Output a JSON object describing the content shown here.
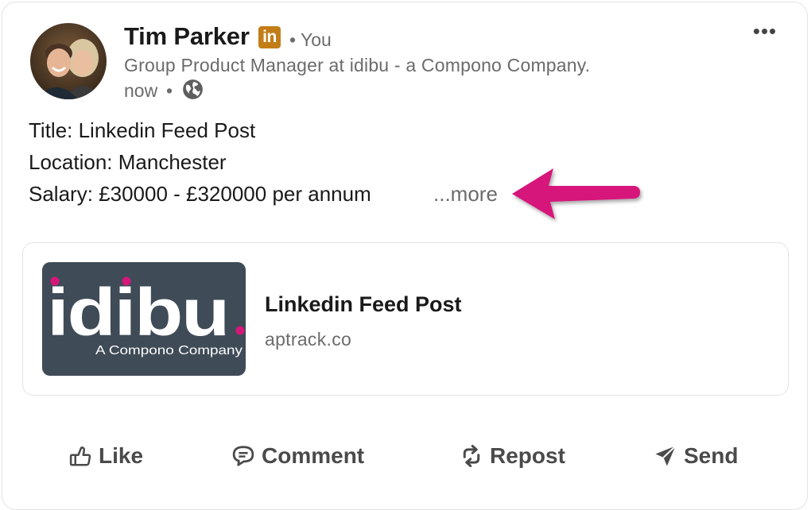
{
  "author": {
    "name": "Tim Parker",
    "badge": "in",
    "you_label": "• You",
    "headline": "Group Product Manager at idibu - a Compono Company.",
    "time": "now",
    "time_separator": "•",
    "visibility_icon": "globe-icon"
  },
  "menu": {
    "more_label": "•••"
  },
  "post": {
    "lines": [
      "Title: Linkedin Feed Post",
      "Location: Manchester",
      "Salary: £30000 - £320000 per annum"
    ],
    "see_more": "...more",
    "annotation_arrow_color": "#d6177a"
  },
  "link_preview": {
    "thumbnail": {
      "wordmark": "idibu.",
      "tagline": "A Compono Company",
      "bg_color": "#3f4b57",
      "dot_color": "#d6177a"
    },
    "title": "Linkedin Feed Post",
    "domain": "aptrack.co"
  },
  "actions": [
    {
      "label": "Like",
      "icon": "thumbs-up-icon"
    },
    {
      "label": "Comment",
      "icon": "comment-icon"
    },
    {
      "label": "Repost",
      "icon": "repost-icon"
    },
    {
      "label": "Send",
      "icon": "send-icon"
    }
  ],
  "colors": {
    "text_primary": "#1a1a1a",
    "text_secondary": "#6b6b6b",
    "border": "#e3e3e3",
    "premium_badge": "#c37d16"
  }
}
